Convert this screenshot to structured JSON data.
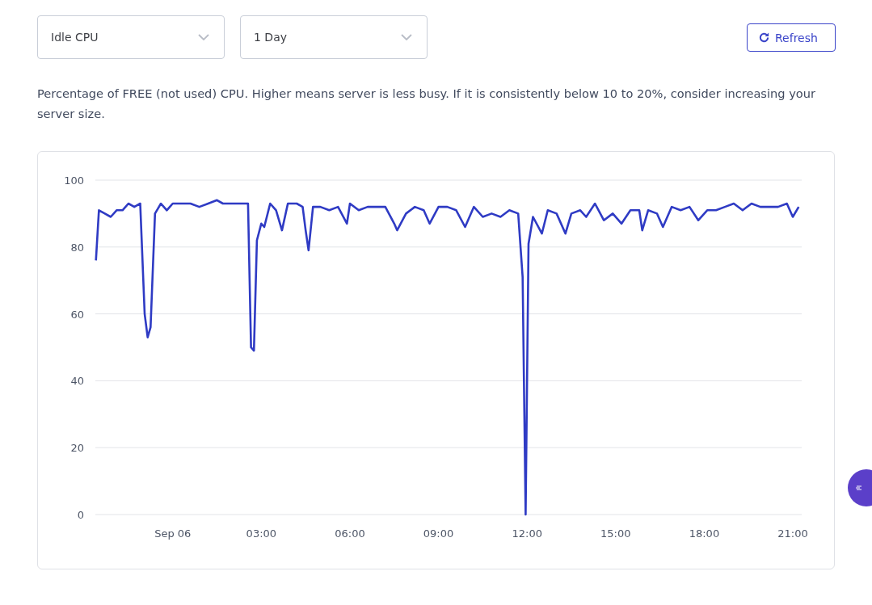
{
  "filters": [
    {
      "kind": "select",
      "value": "Idle CPU"
    },
    {
      "kind": "select",
      "value": "1 Day"
    }
  ],
  "refresh_button": {
    "label": "Refresh"
  },
  "description": "Percentage of FREE (not used) CPU. Higher means server is less busy. If it is consistently below 10 to 20%, consider increasing your server size.",
  "chart_data": {
    "type": "line",
    "x": [
      -2.6,
      -2.5,
      -2.3,
      -2.1,
      -1.9,
      -1.7,
      -1.5,
      -1.3,
      -1.1,
      -0.95,
      -0.85,
      -0.75,
      -0.6,
      -0.4,
      -0.2,
      0,
      0.3,
      0.6,
      0.9,
      1.2,
      1.5,
      1.7,
      2.0,
      2.3,
      2.55,
      2.65,
      2.75,
      2.85,
      3.0,
      3.1,
      3.3,
      3.5,
      3.7,
      3.9,
      4.2,
      4.4,
      4.5,
      4.6,
      4.75,
      5.0,
      5.3,
      5.6,
      5.9,
      6.0,
      6.3,
      6.6,
      6.9,
      7.2,
      7.5,
      7.6,
      7.9,
      8.2,
      8.5,
      8.7,
      9.0,
      9.3,
      9.6,
      9.9,
      10.2,
      10.5,
      10.8,
      11.1,
      11.4,
      11.7,
      11.85,
      11.95,
      12.05,
      12.2,
      12.5,
      12.7,
      13.0,
      13.3,
      13.5,
      13.8,
      14.0,
      14.3,
      14.6,
      14.9,
      15.2,
      15.5,
      15.8,
      15.9,
      16.1,
      16.4,
      16.6,
      16.9,
      17.2,
      17.5,
      17.8,
      18.1,
      18.4,
      18.7,
      19.0,
      19.3,
      19.6,
      19.9,
      20.2,
      20.5,
      20.8,
      21.0,
      21.2
    ],
    "series": [
      {
        "color": "#2f3bc4",
        "values": [
          76,
          91,
          90,
          89,
          91,
          91,
          93,
          92,
          93,
          60,
          53,
          56,
          90,
          93,
          91,
          93,
          93,
          93,
          92,
          93,
          94,
          93,
          93,
          93,
          93,
          50,
          49,
          82,
          87,
          86,
          93,
          91,
          85,
          93,
          93,
          92,
          85,
          79,
          92,
          92,
          91,
          92,
          87,
          93,
          91,
          92,
          92,
          92,
          87,
          85,
          90,
          92,
          91,
          87,
          92,
          92,
          91,
          86,
          92,
          89,
          90,
          89,
          91,
          90,
          71,
          0,
          81,
          89,
          84,
          91,
          90,
          84,
          90,
          91,
          89,
          93,
          88,
          90,
          87,
          91,
          91,
          85,
          91,
          90,
          86,
          92,
          91,
          92,
          88,
          91,
          91,
          92,
          93,
          91,
          93,
          92,
          92,
          92,
          93,
          89,
          92
        ]
      }
    ],
    "xlim": [
      -2.62,
      21.3
    ],
    "ylim": [
      0,
      100
    ],
    "grid": true,
    "xticks": [
      {
        "value": 0,
        "label": "Sep 06"
      },
      {
        "value": 3,
        "label": "03:00"
      },
      {
        "value": 6,
        "label": "06:00"
      },
      {
        "value": 9,
        "label": "09:00"
      },
      {
        "value": 12,
        "label": "12:00"
      },
      {
        "value": 15,
        "label": "15:00"
      },
      {
        "value": 18,
        "label": "18:00"
      },
      {
        "value": 21,
        "label": "21:00"
      }
    ],
    "yticks": [
      0,
      20,
      40,
      60,
      80,
      100
    ]
  }
}
